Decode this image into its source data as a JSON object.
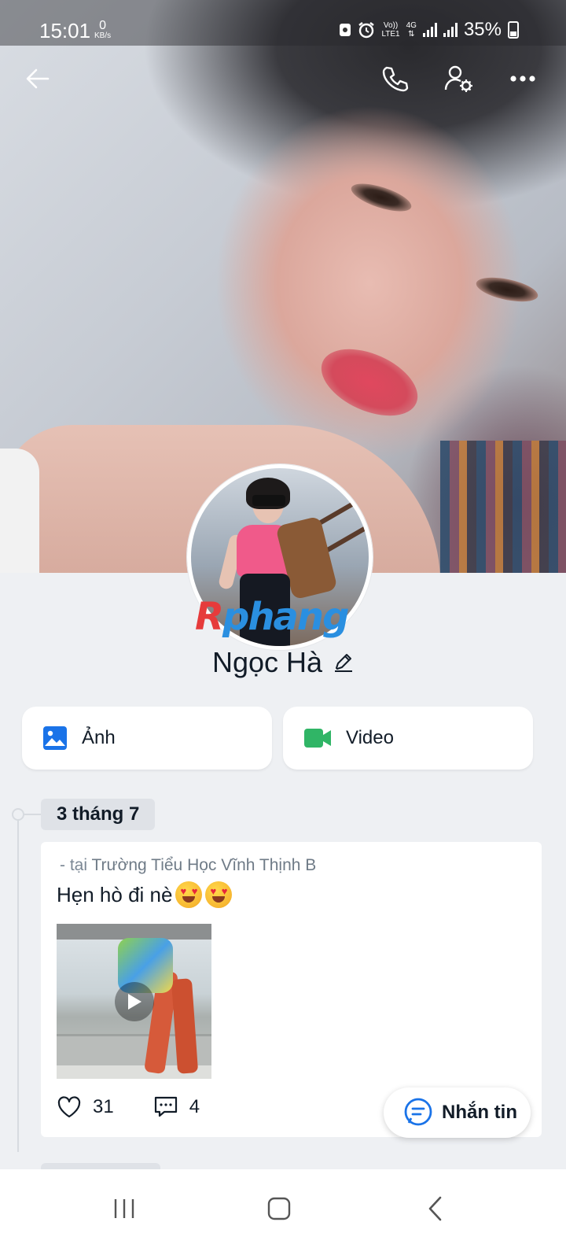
{
  "status_bar": {
    "time": "15:01",
    "speed_value": "0",
    "speed_unit": "KB/s",
    "volte_label": "Vo))",
    "lte_label": "LTE1",
    "network_label": "4G",
    "battery": "35%"
  },
  "top_bar": {
    "back_icon": "arrow-left-icon",
    "call_icon": "phone-icon",
    "settings_icon": "user-settings-icon",
    "more_icon": "more-horizontal-icon"
  },
  "watermark": {
    "part_a": "R",
    "part_b": "phang"
  },
  "profile": {
    "name": "Ngọc Hà",
    "edit_icon": "pencil-icon"
  },
  "media_buttons": {
    "photo_label": "Ảnh",
    "video_label": "Video"
  },
  "timeline": {
    "date": "3 tháng 7",
    "post": {
      "location_prefix": "- tại",
      "location_name": "Trường Tiểu Học Vĩnh Thịnh B",
      "text": "Hẹn hò đi nè",
      "likes": "31",
      "comments": "4"
    }
  },
  "chat_button": {
    "label": "Nhắn tin"
  },
  "colors": {
    "accent_blue": "#1a73e8",
    "video_green": "#30b566",
    "background": "#eef0f3"
  }
}
